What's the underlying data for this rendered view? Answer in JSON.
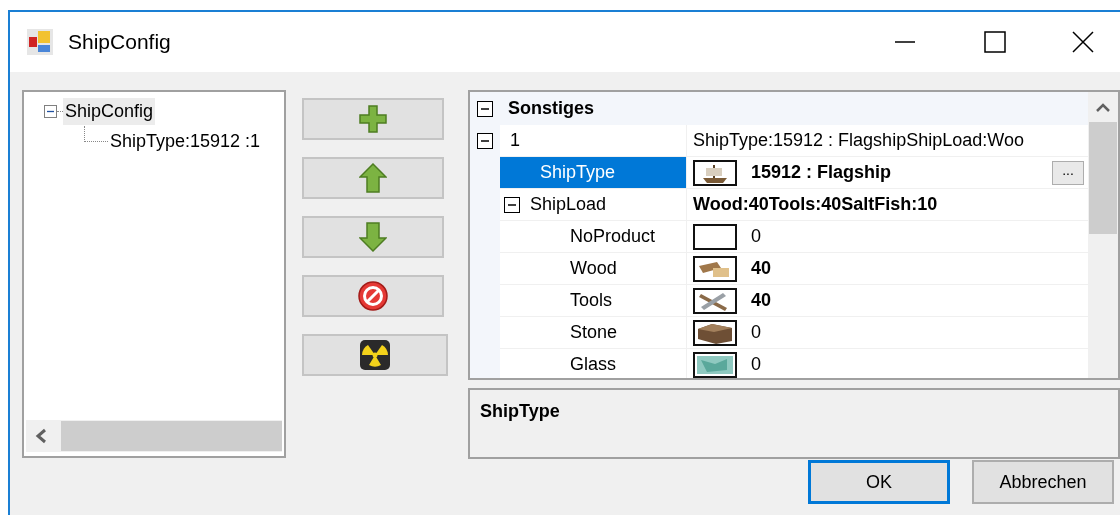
{
  "window": {
    "title": "ShipConfig"
  },
  "tree": {
    "nodes": [
      {
        "label": "ShipConfig",
        "selected": true,
        "expanded": true,
        "children": [
          {
            "label": "ShipType:15912 :1",
            "selected": false
          }
        ]
      }
    ]
  },
  "toolbar": [
    {
      "kind": "add"
    },
    {
      "kind": "up"
    },
    {
      "kind": "down"
    },
    {
      "kind": "remove"
    },
    {
      "kind": "clear"
    }
  ],
  "property_grid": {
    "categories": [
      {
        "label": "Sonstiges",
        "expanded": true,
        "properties": [
          {
            "kind": "text",
            "name": "1",
            "value": "ShipType:15912 : FlagshipShipLoad:Woo",
            "modified": false,
            "selected": false,
            "expanded": true,
            "children": [
              {
                "kind": "ship",
                "name": "ShipType",
                "value": "15912 : Flagship",
                "modified": true,
                "selected": true,
                "button": "..."
              },
              {
                "kind": "text",
                "name": "ShipLoad",
                "value": "Wood:40Tools:40SaltFish:10",
                "modified": true,
                "selected": false,
                "expanded": true,
                "children": [
                  {
                    "kind": "blank",
                    "name": "NoProduct",
                    "value": "0",
                    "modified": false,
                    "selected": false
                  },
                  {
                    "kind": "wood",
                    "name": "Wood",
                    "value": "40",
                    "modified": true,
                    "selected": false
                  },
                  {
                    "kind": "tools",
                    "name": "Tools",
                    "value": "40",
                    "modified": true,
                    "selected": false
                  },
                  {
                    "kind": "stone",
                    "name": "Stone",
                    "value": "0",
                    "modified": false,
                    "selected": false
                  },
                  {
                    "kind": "glass",
                    "name": "Glass",
                    "value": "0",
                    "modified": false,
                    "selected": false
                  }
                ]
              }
            ]
          }
        ]
      }
    ]
  },
  "description": {
    "title": "ShipType"
  },
  "buttons": [
    {
      "label": "OK",
      "default": true
    },
    {
      "label": "Abbrechen",
      "default": false
    }
  ]
}
